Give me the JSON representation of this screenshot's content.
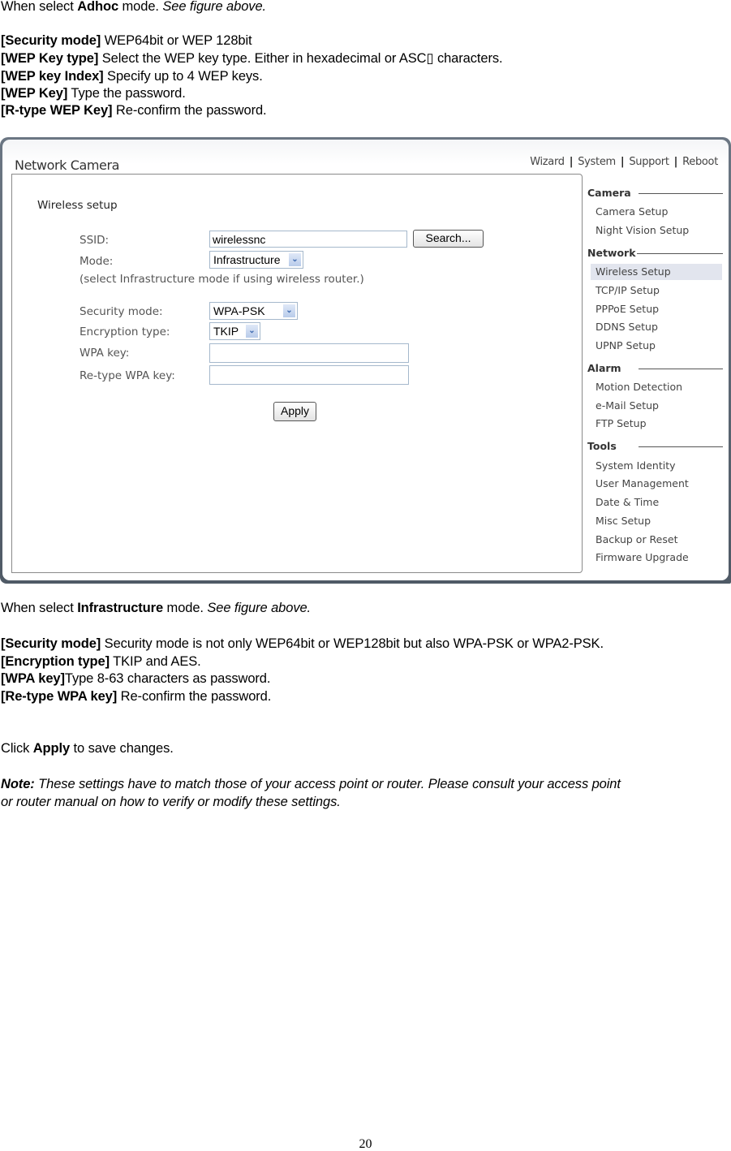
{
  "adhoc_section": {
    "intro": {
      "prefix": "When select ",
      "bold": "Adhoc",
      "middle": " mode. ",
      "italic": "See figure above."
    },
    "items": [
      {
        "term": "[Security mode]",
        "desc": " WEP64bit or WEP 128bit"
      },
      {
        "term": "[WEP Key type]",
        "desc": " Select the WEP key type. Either in hexadecimal or ASC▯  characters."
      },
      {
        "term": "[WEP key Index]",
        "desc": " Specify up to 4 WEP keys."
      },
      {
        "term": "[WEP Key]",
        "desc": " Type the password."
      },
      {
        "term": "[R-type WEP Key]",
        "desc": " Re-confirm the password."
      }
    ]
  },
  "figure": {
    "app_title": "Network Camera",
    "top_nav": [
      "Wizard",
      "System",
      "Support",
      "Reboot"
    ],
    "panel_heading": "Wireless setup",
    "form": {
      "ssid_label": "SSID:",
      "ssid_value": "wirelessnc",
      "search_button": "Search...",
      "mode_label": "Mode:",
      "mode_value": "Infrastructure",
      "mode_hint": "(select Infrastructure mode if using wireless router.)",
      "security_label": "Security mode:",
      "security_value": "WPA-PSK",
      "encryption_label": "Encryption type:",
      "encryption_value": "TKIP",
      "wpa_key_label": "WPA key:",
      "wpa_key_value": "",
      "retype_label": "Re-type WPA key:",
      "retype_value": "",
      "apply_button": "Apply"
    },
    "sidebar": {
      "groups": [
        {
          "title": "Camera",
          "items": [
            "Camera Setup",
            "Night Vision Setup"
          ]
        },
        {
          "title": "Network",
          "items": [
            "Wireless Setup",
            "TCP/IP Setup",
            "PPPoE Setup",
            "DDNS Setup",
            "UPNP Setup"
          ]
        },
        {
          "title": "Alarm",
          "items": [
            "Motion Detection",
            "e-Mail Setup",
            "FTP Setup"
          ]
        },
        {
          "title": "Tools",
          "items": [
            "System Identity",
            "User Management",
            "Date & Time",
            "Misc Setup",
            "Backup or Reset",
            "Firmware Upgrade"
          ]
        }
      ],
      "active_item": "Wireless Setup"
    }
  },
  "infra_section": {
    "intro": {
      "prefix": "When select ",
      "bold": "Infrastructure",
      "middle": " mode. ",
      "italic": "See figure above."
    },
    "items": [
      {
        "term": "[Security mode]",
        "desc": " Security mode is not only WEP64bit or WEP128bit but also WPA-PSK or WPA2-PSK."
      },
      {
        "term": "[Encryption type]",
        "desc": " TKIP and AES."
      },
      {
        "term": "[WPA key]",
        "desc": "Type 8-63 characters as password."
      },
      {
        "term": "[Re-type WPA key]",
        "desc": " Re-confirm the password."
      }
    ]
  },
  "apply_note": {
    "prefix": "Click ",
    "bold": "Apply",
    "suffix": " to save changes."
  },
  "note": {
    "label": "Note:",
    "line1": " These settings have to match those of your access point or router. Please consult your access point",
    "line2": "or router manual on how to verify or modify these settings."
  },
  "page_number": "20"
}
